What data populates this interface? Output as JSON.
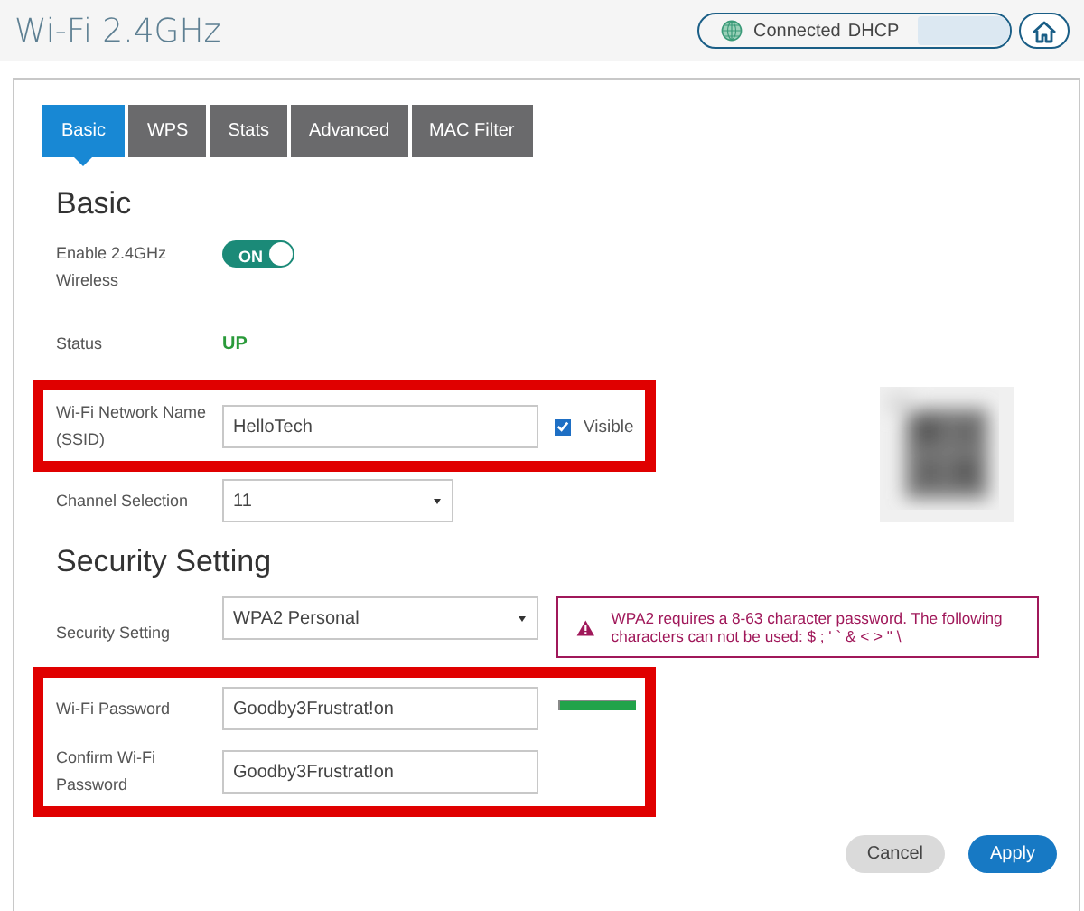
{
  "header": {
    "title": "Wi-Fi 2.4GHz",
    "connection": {
      "status": "Connected",
      "mode": "DHCP"
    }
  },
  "tabs": [
    {
      "label": "Basic",
      "selected": true
    },
    {
      "label": "WPS",
      "selected": false
    },
    {
      "label": "Stats",
      "selected": false
    },
    {
      "label": "Advanced",
      "selected": false
    },
    {
      "label": "MAC Filter",
      "selected": false
    }
  ],
  "sections": [
    {
      "title": "Basic",
      "groups": [
        {
          "highlighted": false,
          "rows": [
            {
              "kind": "toggle",
              "label": "Enable 2.4GHz Wireless",
              "on": true,
              "state_text": "ON"
            }
          ]
        },
        {
          "highlighted": false,
          "rows": [
            {
              "kind": "status",
              "label": "Status",
              "value": "UP"
            }
          ]
        },
        {
          "highlighted": true,
          "aside": {
            "kind": "picture"
          },
          "rows": [
            {
              "kind": "text",
              "label": "Wi-Fi Network Name (SSID)",
              "value": "HelloTech",
              "checkbox": {
                "label": "Visible",
                "checked": true
              }
            }
          ]
        },
        {
          "highlighted": false,
          "rows": [
            {
              "kind": "select",
              "label": "Channel Selection",
              "value": "11"
            }
          ]
        }
      ]
    },
    {
      "title": "Security Setting",
      "groups": [
        {
          "highlighted": false,
          "rows": [
            {
              "kind": "select",
              "label": "Security Setting",
              "value": "WPA2 Personal",
              "warning": "WPA2 requires a 8-63 character password. The following characters can not be used: $ ; ' ` & < > \" \\"
            }
          ]
        },
        {
          "highlighted": true,
          "rows": [
            {
              "kind": "password",
              "label": "Wi-Fi Password",
              "value": "Goodby3Frustrat!on",
              "strength": {
                "level": 1
              }
            },
            {
              "kind": "password",
              "label": "Confirm Wi-Fi Password",
              "value": "Goodby3Frustrat!on"
            }
          ]
        }
      ]
    }
  ],
  "buttons": [
    {
      "label": "Cancel",
      "kind": "secondary"
    },
    {
      "label": "Apply",
      "kind": "primary"
    }
  ]
}
